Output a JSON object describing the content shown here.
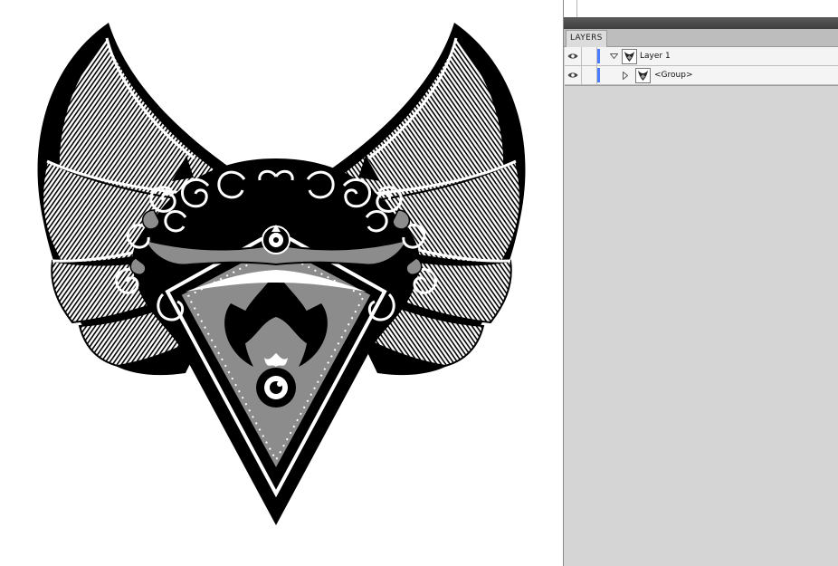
{
  "panel": {
    "tab_label": "LAYERS"
  },
  "layers": [
    {
      "name": "Layer 1",
      "expanded": true,
      "color": "#4a7cff",
      "visible": true
    },
    {
      "name": "<Group>",
      "expanded": false,
      "visible": true
    }
  ],
  "icons": [
    "eye-icon",
    "disclosure-triangle-icon",
    "layer-thumbnail-icon"
  ],
  "colors": {
    "panel_bg": "#d5d5d5",
    "layer_color": "#4a7cff",
    "artwork_gray": "#8c8c8c"
  }
}
